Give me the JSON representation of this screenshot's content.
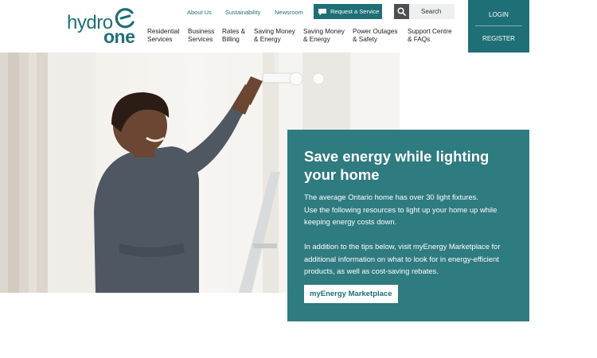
{
  "logo": {
    "line1": "hydro",
    "line2": "one"
  },
  "utility_nav": {
    "about": "About Us",
    "sustainability": "Sustainability",
    "newsroom": "Newsroom",
    "request_service": "Request a Service",
    "search": "Search"
  },
  "main_nav": [
    {
      "line1": "Residential",
      "line2": "Services"
    },
    {
      "line1": "Business",
      "line2": "Services"
    },
    {
      "line1": "Rates &",
      "line2": "Billing"
    },
    {
      "line1": "Saving Money",
      "line2": "& Energy"
    },
    {
      "line1": "Saving Money",
      "line2": "& Energy"
    },
    {
      "line1": "Power Outages",
      "line2": "& Safety"
    },
    {
      "line1": "Support Centre",
      "line2": "& FAQs"
    }
  ],
  "auth": {
    "login": "LOGIN",
    "register": "REGISTER"
  },
  "hero": {
    "title": "Save energy while lighting your home",
    "para1_line1": "The average Ontario home has over 30 light fixtures.",
    "para1_line2": "Use the following resources to light up your home up while keeping energy costs down.",
    "para2": "In addition to the tips below, visit myEnergy Marketplace for additional information on what to look for in energy-efficient products, as well as cost-saving rebates.",
    "cta": "myEnergy Marketplace"
  },
  "colors": {
    "brand": "#1f6f76",
    "card": "#2e7b80",
    "search_btn": "#4b4f52"
  }
}
